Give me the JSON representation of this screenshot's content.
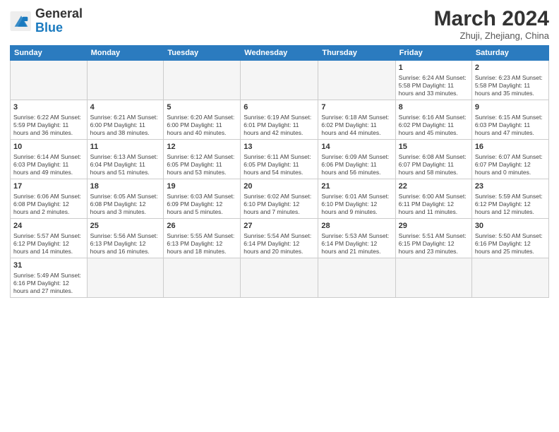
{
  "logo": {
    "general": "General",
    "blue": "Blue"
  },
  "title": "March 2024",
  "subtitle": "Zhuji, Zhejiang, China",
  "days_of_week": [
    "Sunday",
    "Monday",
    "Tuesday",
    "Wednesday",
    "Thursday",
    "Friday",
    "Saturday"
  ],
  "weeks": [
    [
      {
        "day": "",
        "info": "",
        "empty": true
      },
      {
        "day": "",
        "info": "",
        "empty": true
      },
      {
        "day": "",
        "info": "",
        "empty": true
      },
      {
        "day": "",
        "info": "",
        "empty": true
      },
      {
        "day": "",
        "info": "",
        "empty": true
      },
      {
        "day": "1",
        "info": "Sunrise: 6:24 AM\nSunset: 5:58 PM\nDaylight: 11 hours\nand 33 minutes."
      },
      {
        "day": "2",
        "info": "Sunrise: 6:23 AM\nSunset: 5:58 PM\nDaylight: 11 hours\nand 35 minutes."
      }
    ],
    [
      {
        "day": "3",
        "info": "Sunrise: 6:22 AM\nSunset: 5:59 PM\nDaylight: 11 hours\nand 36 minutes."
      },
      {
        "day": "4",
        "info": "Sunrise: 6:21 AM\nSunset: 6:00 PM\nDaylight: 11 hours\nand 38 minutes."
      },
      {
        "day": "5",
        "info": "Sunrise: 6:20 AM\nSunset: 6:00 PM\nDaylight: 11 hours\nand 40 minutes."
      },
      {
        "day": "6",
        "info": "Sunrise: 6:19 AM\nSunset: 6:01 PM\nDaylight: 11 hours\nand 42 minutes."
      },
      {
        "day": "7",
        "info": "Sunrise: 6:18 AM\nSunset: 6:02 PM\nDaylight: 11 hours\nand 44 minutes."
      },
      {
        "day": "8",
        "info": "Sunrise: 6:16 AM\nSunset: 6:02 PM\nDaylight: 11 hours\nand 45 minutes."
      },
      {
        "day": "9",
        "info": "Sunrise: 6:15 AM\nSunset: 6:03 PM\nDaylight: 11 hours\nand 47 minutes."
      }
    ],
    [
      {
        "day": "10",
        "info": "Sunrise: 6:14 AM\nSunset: 6:03 PM\nDaylight: 11 hours\nand 49 minutes."
      },
      {
        "day": "11",
        "info": "Sunrise: 6:13 AM\nSunset: 6:04 PM\nDaylight: 11 hours\nand 51 minutes."
      },
      {
        "day": "12",
        "info": "Sunrise: 6:12 AM\nSunset: 6:05 PM\nDaylight: 11 hours\nand 53 minutes."
      },
      {
        "day": "13",
        "info": "Sunrise: 6:11 AM\nSunset: 6:05 PM\nDaylight: 11 hours\nand 54 minutes."
      },
      {
        "day": "14",
        "info": "Sunrise: 6:09 AM\nSunset: 6:06 PM\nDaylight: 11 hours\nand 56 minutes."
      },
      {
        "day": "15",
        "info": "Sunrise: 6:08 AM\nSunset: 6:07 PM\nDaylight: 11 hours\nand 58 minutes."
      },
      {
        "day": "16",
        "info": "Sunrise: 6:07 AM\nSunset: 6:07 PM\nDaylight: 12 hours\nand 0 minutes."
      }
    ],
    [
      {
        "day": "17",
        "info": "Sunrise: 6:06 AM\nSunset: 6:08 PM\nDaylight: 12 hours\nand 2 minutes."
      },
      {
        "day": "18",
        "info": "Sunrise: 6:05 AM\nSunset: 6:08 PM\nDaylight: 12 hours\nand 3 minutes."
      },
      {
        "day": "19",
        "info": "Sunrise: 6:03 AM\nSunset: 6:09 PM\nDaylight: 12 hours\nand 5 minutes."
      },
      {
        "day": "20",
        "info": "Sunrise: 6:02 AM\nSunset: 6:10 PM\nDaylight: 12 hours\nand 7 minutes."
      },
      {
        "day": "21",
        "info": "Sunrise: 6:01 AM\nSunset: 6:10 PM\nDaylight: 12 hours\nand 9 minutes."
      },
      {
        "day": "22",
        "info": "Sunrise: 6:00 AM\nSunset: 6:11 PM\nDaylight: 12 hours\nand 11 minutes."
      },
      {
        "day": "23",
        "info": "Sunrise: 5:59 AM\nSunset: 6:12 PM\nDaylight: 12 hours\nand 12 minutes."
      }
    ],
    [
      {
        "day": "24",
        "info": "Sunrise: 5:57 AM\nSunset: 6:12 PM\nDaylight: 12 hours\nand 14 minutes."
      },
      {
        "day": "25",
        "info": "Sunrise: 5:56 AM\nSunset: 6:13 PM\nDaylight: 12 hours\nand 16 minutes."
      },
      {
        "day": "26",
        "info": "Sunrise: 5:55 AM\nSunset: 6:13 PM\nDaylight: 12 hours\nand 18 minutes."
      },
      {
        "day": "27",
        "info": "Sunrise: 5:54 AM\nSunset: 6:14 PM\nDaylight: 12 hours\nand 20 minutes."
      },
      {
        "day": "28",
        "info": "Sunrise: 5:53 AM\nSunset: 6:14 PM\nDaylight: 12 hours\nand 21 minutes."
      },
      {
        "day": "29",
        "info": "Sunrise: 5:51 AM\nSunset: 6:15 PM\nDaylight: 12 hours\nand 23 minutes."
      },
      {
        "day": "30",
        "info": "Sunrise: 5:50 AM\nSunset: 6:16 PM\nDaylight: 12 hours\nand 25 minutes."
      }
    ],
    [
      {
        "day": "31",
        "info": "Sunrise: 5:49 AM\nSunset: 6:16 PM\nDaylight: 12 hours\nand 27 minutes."
      },
      {
        "day": "",
        "info": "",
        "empty": true
      },
      {
        "day": "",
        "info": "",
        "empty": true
      },
      {
        "day": "",
        "info": "",
        "empty": true
      },
      {
        "day": "",
        "info": "",
        "empty": true
      },
      {
        "day": "",
        "info": "",
        "empty": true
      },
      {
        "day": "",
        "info": "",
        "empty": true
      }
    ]
  ]
}
